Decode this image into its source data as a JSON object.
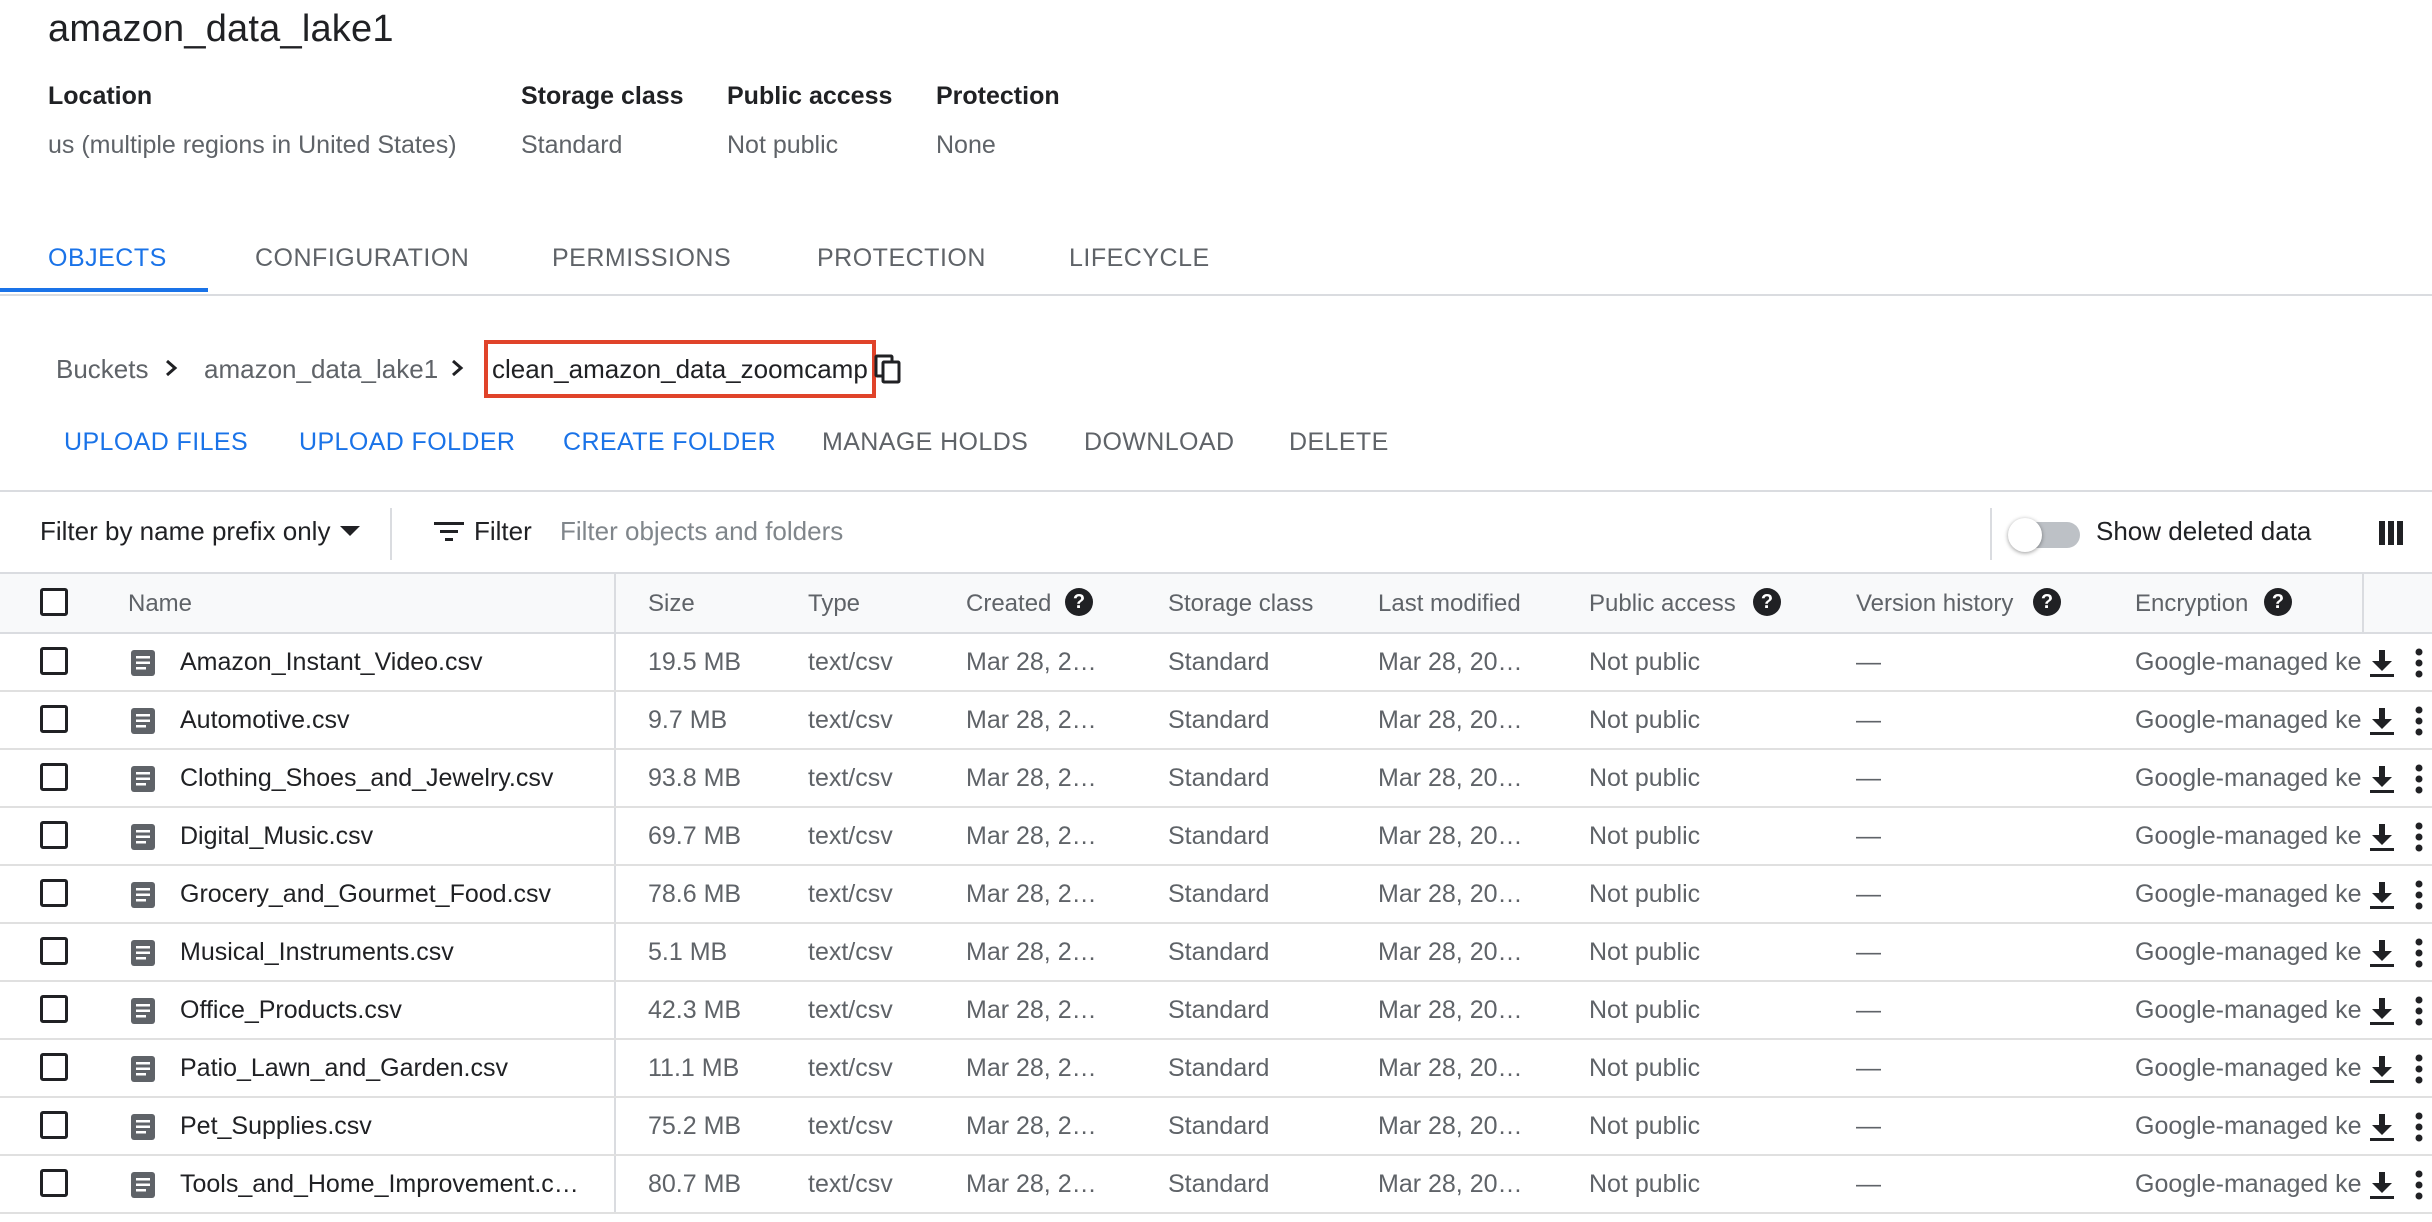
{
  "bucket": {
    "name": "amazon_data_lake1",
    "meta": [
      {
        "label": "Location",
        "value": "us (multiple regions in United States)"
      },
      {
        "label": "Storage class",
        "value": "Standard"
      },
      {
        "label": "Public access",
        "value": "Not public"
      },
      {
        "label": "Protection",
        "value": "None"
      }
    ]
  },
  "tabs": [
    {
      "label": "OBJECTS",
      "active": true
    },
    {
      "label": "CONFIGURATION",
      "active": false
    },
    {
      "label": "PERMISSIONS",
      "active": false
    },
    {
      "label": "PROTECTION",
      "active": false
    },
    {
      "label": "LIFECYCLE",
      "active": false
    }
  ],
  "breadcrumb": {
    "items": [
      "Buckets",
      "amazon_data_lake1"
    ],
    "current": "clean_amazon_data_zoomcamp"
  },
  "actions": [
    {
      "label": "UPLOAD FILES",
      "enabled": true
    },
    {
      "label": "UPLOAD FOLDER",
      "enabled": true
    },
    {
      "label": "CREATE FOLDER",
      "enabled": true
    },
    {
      "label": "MANAGE HOLDS",
      "enabled": false
    },
    {
      "label": "DOWNLOAD",
      "enabled": false
    },
    {
      "label": "DELETE",
      "enabled": false
    }
  ],
  "filterbar": {
    "prefix_option": "Filter by name prefix only",
    "filter_label": "Filter",
    "placeholder": "Filter objects and folders",
    "show_deleted_label": "Show deleted data",
    "show_deleted_on": false
  },
  "table": {
    "headers": {
      "name": "Name",
      "size": "Size",
      "type": "Type",
      "created": "Created",
      "storage_class": "Storage class",
      "last_modified": "Last modified",
      "public_access": "Public access",
      "version_history": "Version history",
      "encryption": "Encryption"
    },
    "rows": [
      {
        "name": "Amazon_Instant_Video.csv",
        "size": "19.5 MB",
        "type": "text/csv",
        "created": "Mar 28, 2…",
        "storage_class": "Standard",
        "last_modified": "Mar 28, 20…",
        "public_access": "Not public",
        "version_history": "—",
        "encryption": "Google-managed ke"
      },
      {
        "name": "Automotive.csv",
        "size": "9.7 MB",
        "type": "text/csv",
        "created": "Mar 28, 2…",
        "storage_class": "Standard",
        "last_modified": "Mar 28, 20…",
        "public_access": "Not public",
        "version_history": "—",
        "encryption": "Google-managed ke"
      },
      {
        "name": "Clothing_Shoes_and_Jewelry.csv",
        "size": "93.8 MB",
        "type": "text/csv",
        "created": "Mar 28, 2…",
        "storage_class": "Standard",
        "last_modified": "Mar 28, 20…",
        "public_access": "Not public",
        "version_history": "—",
        "encryption": "Google-managed ke"
      },
      {
        "name": "Digital_Music.csv",
        "size": "69.7 MB",
        "type": "text/csv",
        "created": "Mar 28, 2…",
        "storage_class": "Standard",
        "last_modified": "Mar 28, 20…",
        "public_access": "Not public",
        "version_history": "—",
        "encryption": "Google-managed ke"
      },
      {
        "name": "Grocery_and_Gourmet_Food.csv",
        "size": "78.6 MB",
        "type": "text/csv",
        "created": "Mar 28, 2…",
        "storage_class": "Standard",
        "last_modified": "Mar 28, 20…",
        "public_access": "Not public",
        "version_history": "—",
        "encryption": "Google-managed ke"
      },
      {
        "name": "Musical_Instruments.csv",
        "size": "5.1 MB",
        "type": "text/csv",
        "created": "Mar 28, 2…",
        "storage_class": "Standard",
        "last_modified": "Mar 28, 20…",
        "public_access": "Not public",
        "version_history": "—",
        "encryption": "Google-managed ke"
      },
      {
        "name": "Office_Products.csv",
        "size": "42.3 MB",
        "type": "text/csv",
        "created": "Mar 28, 2…",
        "storage_class": "Standard",
        "last_modified": "Mar 28, 20…",
        "public_access": "Not public",
        "version_history": "—",
        "encryption": "Google-managed ke"
      },
      {
        "name": "Patio_Lawn_and_Garden.csv",
        "size": "11.1 MB",
        "type": "text/csv",
        "created": "Mar 28, 2…",
        "storage_class": "Standard",
        "last_modified": "Mar 28, 20…",
        "public_access": "Not public",
        "version_history": "—",
        "encryption": "Google-managed ke"
      },
      {
        "name": "Pet_Supplies.csv",
        "size": "75.2 MB",
        "type": "text/csv",
        "created": "Mar 28, 2…",
        "storage_class": "Standard",
        "last_modified": "Mar 28, 20…",
        "public_access": "Not public",
        "version_history": "—",
        "encryption": "Google-managed ke"
      },
      {
        "name": "Tools_and_Home_Improvement.c…",
        "size": "80.7 MB",
        "type": "text/csv",
        "created": "Mar 28, 2…",
        "storage_class": "Standard",
        "last_modified": "Mar 28, 20…",
        "public_access": "Not public",
        "version_history": "—",
        "encryption": "Google-managed ke"
      }
    ]
  },
  "icons": {
    "breadcrumb_separator": "chevron-right-icon",
    "copy": "copy-icon",
    "filter": "filter-list-icon",
    "columns": "column-display-icon",
    "help": "help-icon",
    "file": "file-icon",
    "download": "download-icon",
    "more": "more-vert-icon"
  },
  "colors": {
    "accent": "#1a73e8",
    "highlight_border": "#e0432a",
    "muted_text": "#5f6368",
    "divider": "#dadce0"
  }
}
